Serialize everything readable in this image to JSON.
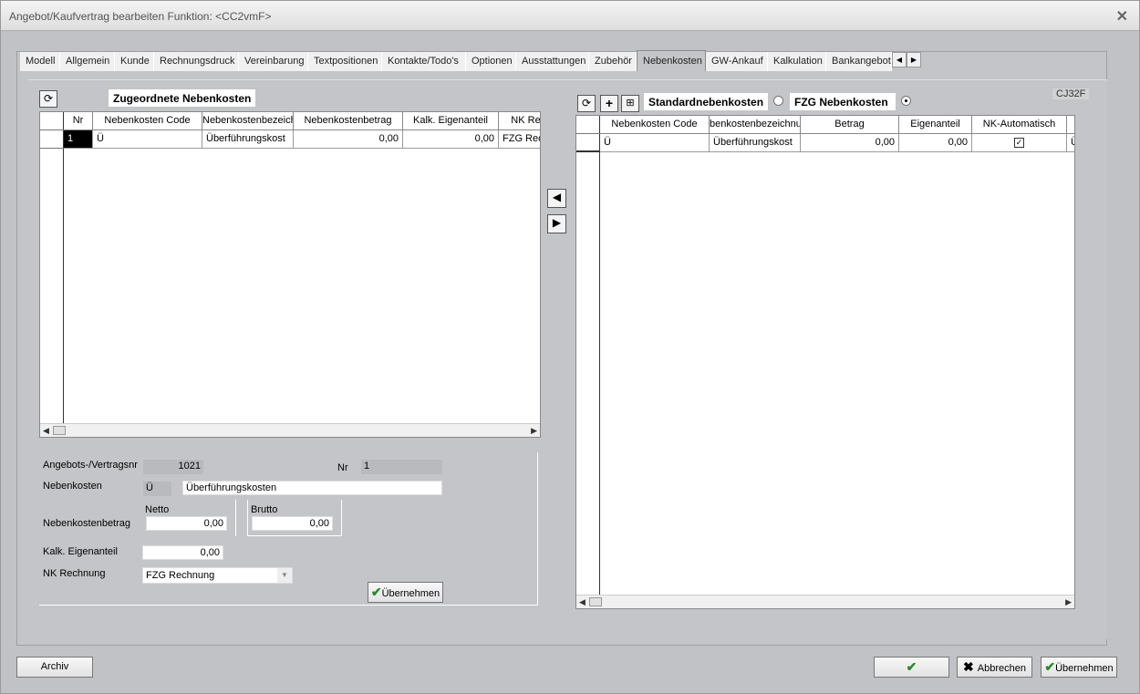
{
  "window": {
    "title": "Angebot/Kaufvertrag bearbeiten   Funktion: <CC2vmF>"
  },
  "tabs": [
    {
      "label": "Modell",
      "w": 44
    },
    {
      "label": "Allgemein",
      "w": 60
    },
    {
      "label": "Kunde",
      "w": 43
    },
    {
      "label": "Rechnungsdruck",
      "w": 93
    },
    {
      "label": "Vereinbarung",
      "w": 76
    },
    {
      "label": "Textpositionen",
      "w": 81
    },
    {
      "label": "Kontakte/Todo's",
      "w": 92
    },
    {
      "label": "Optionen",
      "w": 55
    },
    {
      "label": "Ausstattungen",
      "w": 80
    },
    {
      "label": "Zubehör",
      "w": 52
    },
    {
      "label": "Nebenkosten",
      "w": 76
    },
    {
      "label": "GW-Ankauf",
      "w": 68
    },
    {
      "label": "Kalkulation",
      "w": 64
    },
    {
      "label": "Bankangebot",
      "w": 72
    }
  ],
  "active_tab": "Nebenkosten",
  "code_label": "CJ32F",
  "left": {
    "title": "Zugeordnete Nebenkosten",
    "columns": [
      "Nr",
      "Nebenkosten Code",
      "Nebenkostenbezeich",
      "Nebenkostenbetrag",
      "Kalk. Eigenanteil",
      "NK Re"
    ],
    "rows": [
      {
        "nr": "1",
        "code": "Ü",
        "bez": "Überführungskost",
        "betrag": "0,00",
        "eigen": "0,00",
        "nkre": "FZG Rec"
      }
    ]
  },
  "right": {
    "title_std": "Standardnebenkosten",
    "title_fzg": "FZG Nebenkosten",
    "columns": [
      "Nebenkosten Code",
      "benkostenbezeichnu",
      "Betrag",
      "Eigenanteil",
      "NK-Automatisch"
    ],
    "rows": [
      {
        "code": "Ü",
        "bez": "Überführungskost",
        "betrag": "0,00",
        "eigen": "0,00",
        "auto": "✓",
        "extra": "Ü"
      }
    ]
  },
  "form": {
    "vertragsnr_label": "Angebots-/Vertragsnr",
    "vertragsnr": "1021",
    "nr_label": "Nr",
    "nr": "1",
    "nebenkosten_label": "Nebenkosten",
    "nk_code": "Ü",
    "nk_text": "Überführungskosten",
    "betrag_label": "Nebenkostenbetrag",
    "netto_label": "Netto",
    "netto": "0,00",
    "brutto_label": "Brutto",
    "brutto": "0,00",
    "eigen_label": "Kalk. Eigenanteil",
    "eigen": "0,00",
    "nkrech_label": "NK Rechnung",
    "nkrech": "FZG Rechnung",
    "uebernehmen": "Übernehmen"
  },
  "footer": {
    "archiv": "Archiv",
    "ok": "OK",
    "abbrechen": "Abbrechen",
    "uebernehmen": "Übernehmen"
  }
}
